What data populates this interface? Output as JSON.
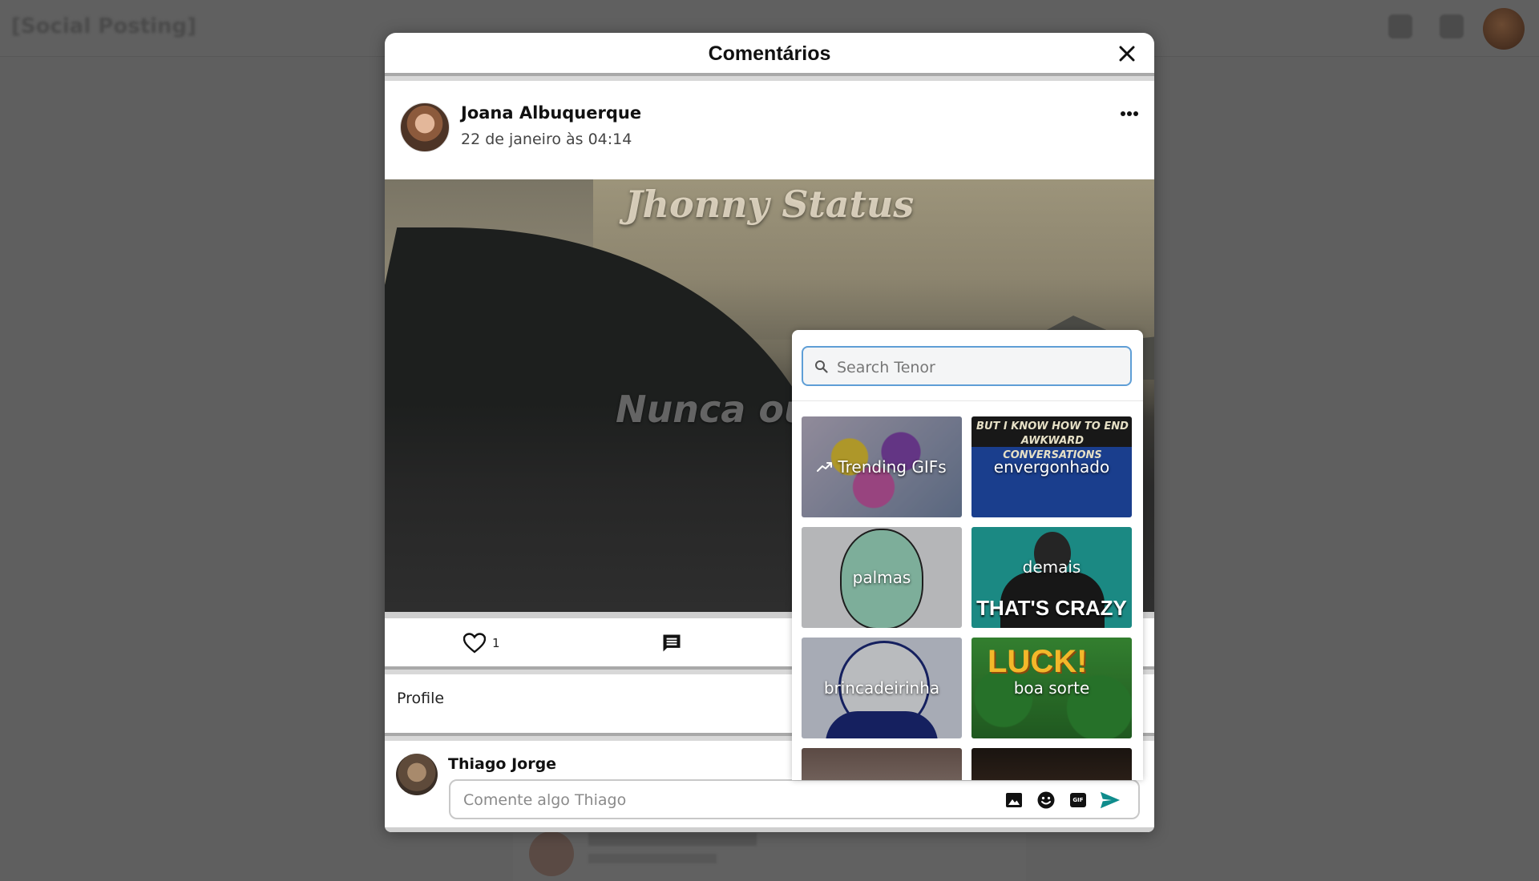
{
  "app": {
    "brand": "[Social Posting]"
  },
  "modal": {
    "title": "Comentários",
    "post": {
      "author": "Joana Albuquerque",
      "date": "22 de janeiro às 04:14",
      "media_watermark": "Jhonny Status",
      "media_text": "Nunca ouv",
      "likes": "1"
    },
    "profile_label": "Profile",
    "composer": {
      "user_name": "Thiago Jorge",
      "placeholder": "Comente algo Thiago"
    }
  },
  "gif_picker": {
    "search_placeholder": "Search Tenor",
    "tiles": [
      {
        "label": "Trending GIFs",
        "icon": "trending-icon"
      },
      {
        "label": "envergonhado",
        "caption": "BUT I KNOW HOW TO END AWKWARD CONVERSATIONS"
      },
      {
        "label": "palmas"
      },
      {
        "label": "demais",
        "caption": "THAT'S CRAZY"
      },
      {
        "label": "brincadeirinha"
      },
      {
        "label": "boa sorte",
        "caption": "LUCK!"
      }
    ]
  },
  "colors": {
    "overlay": "#5f5f5f",
    "send_accent": "#0f8c8c",
    "search_border": "#5e9ed6"
  }
}
